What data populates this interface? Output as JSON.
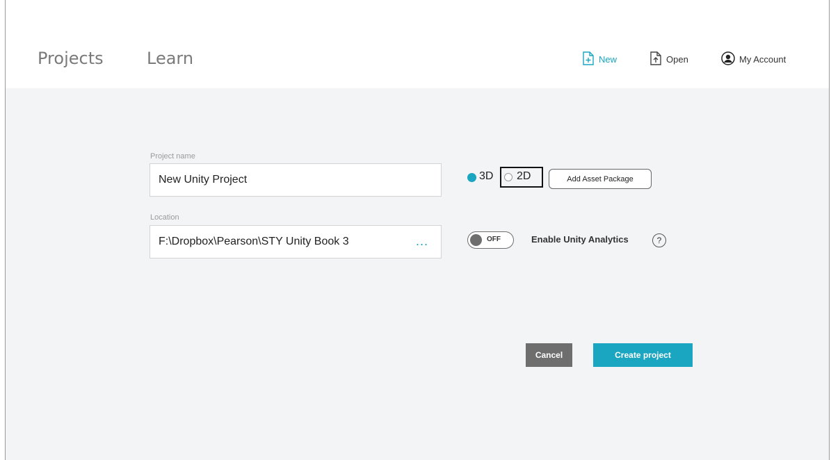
{
  "nav": {
    "projects": "Projects",
    "learn": "Learn"
  },
  "actions": {
    "new_label": "New",
    "open_label": "Open",
    "account_label": "My Account"
  },
  "form": {
    "project_name_label": "Project name",
    "project_name_value": "New Unity Project",
    "location_label": "Location",
    "location_value": "F:\\Dropbox\\Pearson\\STY Unity Book 3",
    "browse_label": "...",
    "option_3d": "3D",
    "option_2d": "2D",
    "selected_option": "3D",
    "add_asset_package": "Add Asset Package",
    "analytics_toggle": "OFF",
    "analytics_label": "Enable Unity Analytics",
    "help_symbol": "?"
  },
  "buttons": {
    "cancel": "Cancel",
    "create": "Create project"
  },
  "colors": {
    "accent": "#1aa5c0",
    "cancel_bg": "#6e6e6e",
    "content_bg": "#f3f4f6"
  }
}
